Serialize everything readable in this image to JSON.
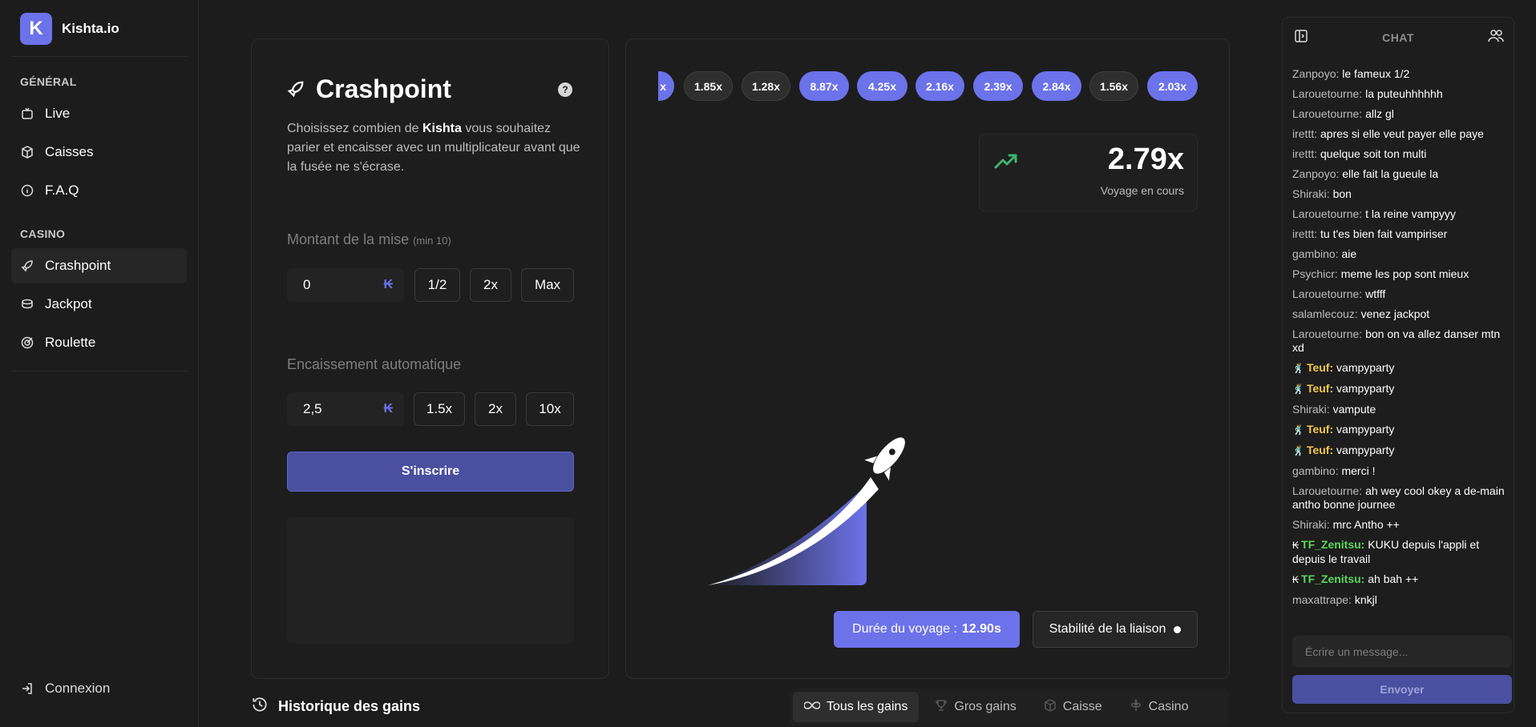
{
  "brand": {
    "name": "Kishta.io",
    "logo_letter": "K",
    "accent": "#6c72ea"
  },
  "sidebar": {
    "section_general": "GÉNÉRAL",
    "general_items": [
      {
        "label": "Live",
        "icon": "tv-icon"
      },
      {
        "label": "Caisses",
        "icon": "box-icon"
      },
      {
        "label": "F.A.Q",
        "icon": "info-icon"
      }
    ],
    "section_casino": "CASINO",
    "casino_items": [
      {
        "label": "Crashpoint",
        "icon": "rocket-icon",
        "active": true
      },
      {
        "label": "Jackpot",
        "icon": "coins-icon"
      },
      {
        "label": "Roulette",
        "icon": "target-icon"
      }
    ],
    "login": "Connexion"
  },
  "game": {
    "title": "Crashpoint",
    "help": "?",
    "desc_prefix": "Choisissez combien de ",
    "desc_bold": "Kishta",
    "desc_suffix": " vous souhaitez parier et encaisser avec un multiplicateur avant que la fusée ne s'écrase.",
    "bet_label": "Montant de la mise",
    "bet_min": "(min 10)",
    "bet_value": "0",
    "currency": "₭",
    "bet_buttons": [
      "1/2",
      "2x",
      "Max"
    ],
    "auto_label": "Encaissement automatique",
    "auto_value": "2,5",
    "auto_buttons": [
      "1.5x",
      "2x",
      "10x"
    ],
    "submit": "S'inscrire"
  },
  "multipliers": [
    {
      "label": "x",
      "style": "blue"
    },
    {
      "label": "1.85x",
      "style": "dark"
    },
    {
      "label": "1.28x",
      "style": "dark"
    },
    {
      "label": "8.87x",
      "style": "blue"
    },
    {
      "label": "4.25x",
      "style": "blue"
    },
    {
      "label": "2.16x",
      "style": "blue"
    },
    {
      "label": "2.39x",
      "style": "blue"
    },
    {
      "label": "2.84x",
      "style": "blue"
    },
    {
      "label": "1.56x",
      "style": "dark"
    },
    {
      "label": "2.03x",
      "style": "blue"
    }
  ],
  "current": {
    "value": "2.79x",
    "status": "Voyage en cours"
  },
  "duration": {
    "label": "Durée du voyage :",
    "value": "12.90s"
  },
  "stability": {
    "label": "Stabilité de la liaison"
  },
  "history": {
    "title": "Historique des gains",
    "tabs": [
      {
        "label": "Tous les gains",
        "icon": "infinity-icon",
        "active": true
      },
      {
        "label": "Gros gains",
        "icon": "trophy-icon"
      },
      {
        "label": "Caisse",
        "icon": "box-icon"
      },
      {
        "label": "Casino",
        "icon": "clover-icon"
      }
    ]
  },
  "chat": {
    "title": "CHAT",
    "messages": [
      {
        "user": "Zanpoyo:",
        "text": "le fameux 1/2"
      },
      {
        "user": "Larouetourne:",
        "text": "la puteuhhhhhh"
      },
      {
        "user": "Larouetourne:",
        "text": "allz gl"
      },
      {
        "user": "irettt:",
        "text": "apres si elle veut payer elle paye"
      },
      {
        "user": "irettt:",
        "text": "quelque soit ton multi"
      },
      {
        "user": "Zanpoyo:",
        "text": "elle fait la gueule la"
      },
      {
        "user": "Shiraki:",
        "text": "bon"
      },
      {
        "user": "Larouetourne:",
        "text": "t la reine vampyyy"
      },
      {
        "user": "irettt:",
        "text": "tu t'es bien fait vampiriser"
      },
      {
        "user": "gambino:",
        "text": "aie"
      },
      {
        "user": "Psychicr:",
        "text": "meme les pop sont mieux"
      },
      {
        "user": "Larouetourne:",
        "text": "wtfff"
      },
      {
        "user": "salamlecouz:",
        "text": "venez jackpot"
      },
      {
        "user": "Larouetourne:",
        "text": "bon on va allez danser mtn xd"
      },
      {
        "user": "Teuf:",
        "text": "vampyparty",
        "style": "gold",
        "badge": "🕺"
      },
      {
        "user": "Teuf:",
        "text": "vampyparty",
        "style": "gold",
        "badge": "🕺"
      },
      {
        "user": "Shiraki:",
        "text": "vampute"
      },
      {
        "user": "Teuf:",
        "text": "vampyparty",
        "style": "gold",
        "badge": "🕺"
      },
      {
        "user": "Teuf:",
        "text": "vampyparty",
        "style": "gold",
        "badge": "🕺"
      },
      {
        "user": "gambino:",
        "text": "merci !"
      },
      {
        "user": "Larouetourne:",
        "text": "ah wey cool okey a de-main antho bonne journee"
      },
      {
        "user": "Shiraki:",
        "text": "mrc Antho ++"
      },
      {
        "user": "TF_Zenitsu:",
        "text": "KUKU depuis l'appli et depuis le travail",
        "style": "green",
        "badge": "₭"
      },
      {
        "user": "TF_Zenitsu:",
        "text": "ah bah ++",
        "style": "green",
        "badge": "₭"
      },
      {
        "user": "maxattrape:",
        "text": "knkjl"
      }
    ],
    "input_placeholder": "Écrire un message...",
    "send": "Envoyer"
  }
}
